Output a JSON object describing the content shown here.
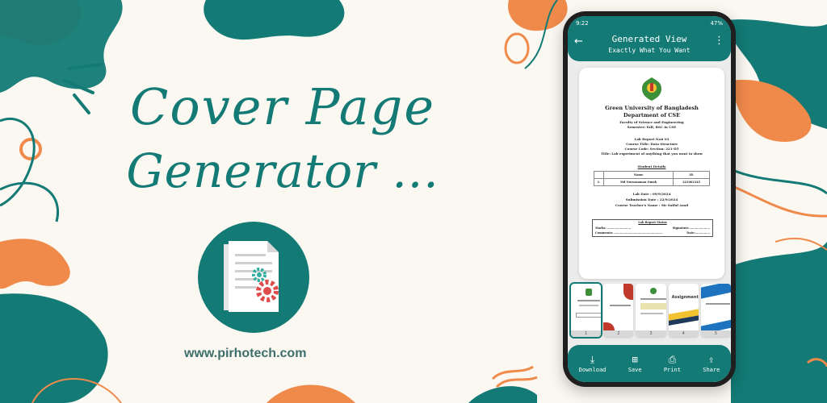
{
  "headline": {
    "line1": "Cover Page",
    "line2": "Generator ..."
  },
  "website": "www.pirhotech.com",
  "colors": {
    "teal": "#137a75",
    "orange": "#f08a4b",
    "background": "#fbf7f1"
  },
  "phone": {
    "status": {
      "time": "9:22",
      "battery": "47%"
    },
    "appbar": {
      "title": "Generated View",
      "subtitle": "Exactly What You Want",
      "back_icon": "arrow-left-icon",
      "menu_icon": "more-vert-icon"
    },
    "document": {
      "university": "Green University of Bangladesh",
      "department": "Department of CSE",
      "faculty": "Faculty of Science and Engineering",
      "semester": "Semester: Fall, BSC in CSE",
      "report_no": "Lab Report No# 03",
      "course_title": "Course Title:  Data Structure",
      "course_code": "Course Code:                Section: 221-D5",
      "title": "Title: Lab experiment of anything that you want to show",
      "student_details_label": "Student Details",
      "table_headers": [
        "",
        "Name",
        "ID"
      ],
      "table_rows": [
        [
          "1.",
          "Md Nuruzzaman Omok",
          "221002345"
        ]
      ],
      "lab_date": "Lab Date             : 09/9/2024",
      "submission_date": "Submission Date       : 22/9/2024",
      "teacher": "Course Teacher's Name    : Sir Saiful Azad",
      "status_title": "Lab Report Status",
      "marks": "Marks: ........................",
      "signature": "Signature:.....................",
      "comments": "Comments: .................................................",
      "date": "Date:..............."
    },
    "thumbnails": [
      "1",
      "2",
      "3",
      "4",
      "5"
    ],
    "bottom_actions": [
      {
        "label": "Download",
        "icon": "download-icon"
      },
      {
        "label": "Save",
        "icon": "save-icon"
      },
      {
        "label": "Print",
        "icon": "print-icon"
      },
      {
        "label": "Share",
        "icon": "share-icon"
      }
    ]
  }
}
